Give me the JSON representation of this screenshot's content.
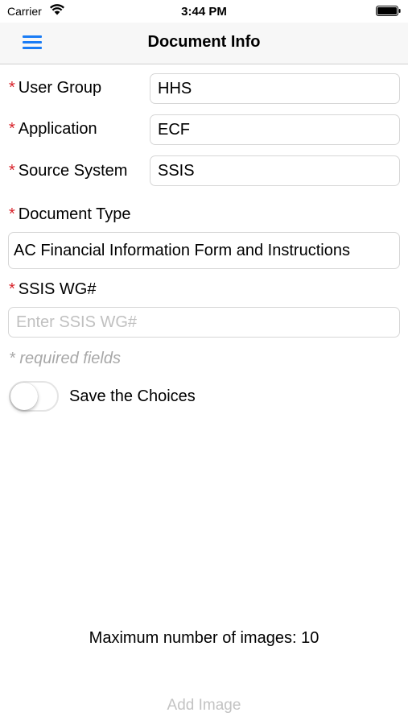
{
  "status_bar": {
    "carrier": "Carrier",
    "time": "3:44 PM",
    "wifi_icon": "wifi-icon",
    "battery_icon": "battery-icon"
  },
  "nav": {
    "title": "Document Info",
    "menu_icon": "hamburger-menu-icon",
    "accent_color": "#1a7cf5"
  },
  "form": {
    "required_marker": "*",
    "required_color": "#d8222a",
    "user_group": {
      "label": "User Group",
      "value": "HHS"
    },
    "application": {
      "label": "Application",
      "value": "ECF"
    },
    "source_system": {
      "label": "Source System",
      "value": "SSIS"
    },
    "document_type": {
      "label": "Document Type",
      "value": "AC Financial Information Form and Instructions"
    },
    "ssis_wg": {
      "label": "SSIS WG#",
      "value": "",
      "placeholder": "Enter SSIS WG#"
    },
    "required_note": "* required fields",
    "save_choices": {
      "label": "Save the Choices",
      "enabled": false
    }
  },
  "footer": {
    "max_images": "Maximum number of images: 10",
    "add_image": "Add Image"
  }
}
